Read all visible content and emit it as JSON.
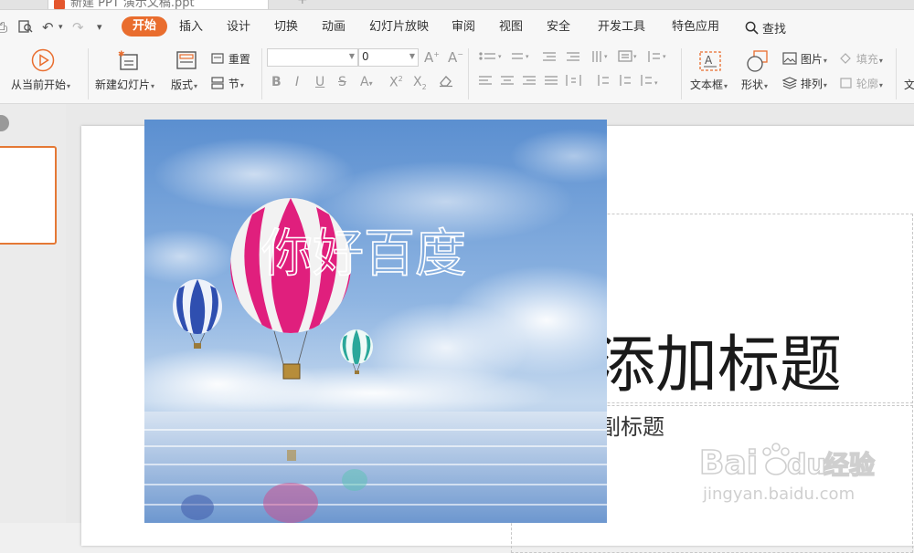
{
  "tabs": {
    "doc_title": "新建 PPT 演示文稿.ppt",
    "add": "+"
  },
  "menu": {
    "items": [
      "开始",
      "插入",
      "设计",
      "切换",
      "动画",
      "幻灯片放映",
      "审阅",
      "视图",
      "安全",
      "开发工具",
      "特色应用"
    ],
    "active": "开始",
    "search_label": "查找"
  },
  "ribbon": {
    "play_from_current": "从当前开始",
    "new_slide": "新建幻灯片",
    "layout": "版式",
    "reset": "重置",
    "section": "节",
    "font_name": "",
    "font_size": "0",
    "text_box": "文本框",
    "shape": "形状",
    "picture": "图片",
    "fill": "填充",
    "arrange": "排列",
    "outline": "轮廓",
    "text_partial": "文"
  },
  "slide": {
    "title_visible": "添加标题",
    "subtitle_visible": "副标题",
    "picture_text": "你好百度"
  },
  "watermark": {
    "brand": "Bai",
    "brand2": "du",
    "cn": "经验",
    "url": "jingyan.baidu.com"
  },
  "colors": {
    "accent": "#e96d2e",
    "thumb_border": "#e47835"
  }
}
